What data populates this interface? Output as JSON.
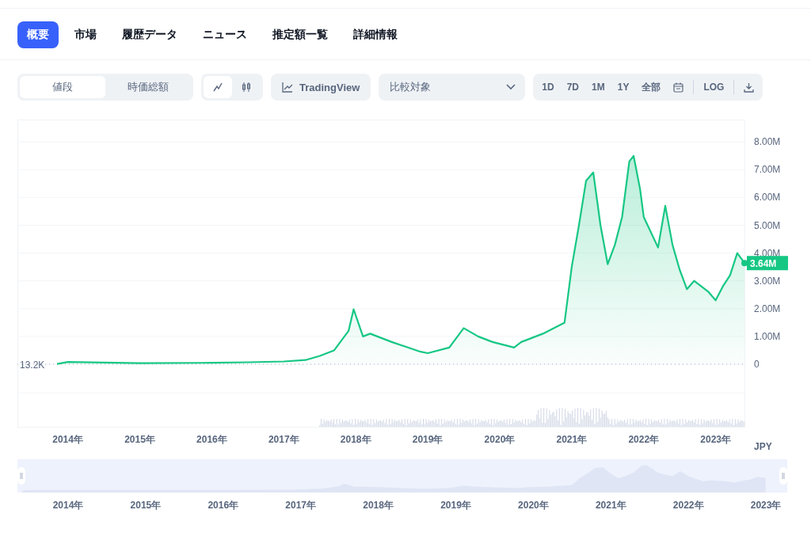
{
  "tabs": [
    {
      "label": "概要",
      "selected": true
    },
    {
      "label": "市場",
      "selected": false
    },
    {
      "label": "履歴データ",
      "selected": false
    },
    {
      "label": "ニュース",
      "selected": false
    },
    {
      "label": "推定額一覧",
      "selected": false
    },
    {
      "label": "詳細情報",
      "selected": false
    }
  ],
  "toolbar": {
    "metric": [
      {
        "label": "値段",
        "selected": true
      },
      {
        "label": "時価総額",
        "selected": false
      }
    ],
    "chart_type": [
      {
        "kind": "line",
        "selected": true
      },
      {
        "kind": "candle",
        "selected": false
      }
    ],
    "tradingview": {
      "label": "TradingView"
    },
    "compare": {
      "label": "比較対象"
    },
    "ranges": [
      {
        "label": "1D",
        "selected": false
      },
      {
        "label": "7D",
        "selected": false
      },
      {
        "label": "1M",
        "selected": false
      },
      {
        "label": "1Y",
        "selected": false
      },
      {
        "label": "全部",
        "selected": false
      }
    ],
    "log": {
      "label": "LOG",
      "selected": false
    }
  },
  "chart": {
    "start_label": "13.2K",
    "price_label": "3.64M",
    "currency": "JPY",
    "chart_data": {
      "type": "area",
      "x": [
        2013.85,
        2014.0,
        2014.5,
        2015.0,
        2016.0,
        2016.5,
        2017.0,
        2017.3,
        2017.5,
        2017.7,
        2017.9,
        2017.97,
        2018.1,
        2018.2,
        2018.5,
        2018.9,
        2019.0,
        2019.3,
        2019.5,
        2019.7,
        2019.9,
        2020.2,
        2020.3,
        2020.6,
        2020.9,
        2021.0,
        2021.1,
        2021.2,
        2021.3,
        2021.4,
        2021.5,
        2021.6,
        2021.7,
        2021.8,
        2021.86,
        2021.95,
        2022.0,
        2022.2,
        2022.3,
        2022.4,
        2022.5,
        2022.6,
        2022.7,
        2022.9,
        2023.0,
        2023.1,
        2023.2,
        2023.3,
        2023.4
      ],
      "series": [
        {
          "color": "#16c784",
          "values": [
            10000,
            80000,
            60000,
            40000,
            50000,
            70000,
            100000,
            150000,
            300000,
            500000,
            1200000,
            1980000,
            1000000,
            1100000,
            800000,
            450000,
            400000,
            600000,
            1300000,
            1000000,
            800000,
            600000,
            800000,
            1100000,
            1500000,
            3500000,
            5000000,
            6600000,
            6900000,
            5000000,
            3600000,
            4300000,
            5300000,
            7300000,
            7500000,
            6300000,
            5300000,
            4200000,
            5700000,
            4300000,
            3400000,
            2700000,
            3000000,
            2600000,
            2300000,
            2800000,
            3200000,
            4000000,
            3640000
          ]
        }
      ],
      "xlim": [
        2013.3,
        2023.4
      ],
      "ylim": [
        0,
        8000000
      ],
      "grid": true,
      "yticks": [
        {
          "value": 0,
          "label": "0"
        },
        {
          "value": 1000000,
          "label": "1.00M"
        },
        {
          "value": 2000000,
          "label": "2.00M"
        },
        {
          "value": 3000000,
          "label": "3.00M"
        },
        {
          "value": 4000000,
          "label": "4.00M"
        },
        {
          "value": 5000000,
          "label": "5.00M"
        },
        {
          "value": 6000000,
          "label": "6.00M"
        },
        {
          "value": 7000000,
          "label": "7.00M"
        },
        {
          "value": 8000000,
          "label": "8.00M"
        }
      ],
      "xticks": [
        {
          "value": 2014,
          "label": "2014年"
        },
        {
          "value": 2015,
          "label": "2015年"
        },
        {
          "value": 2016,
          "label": "2016年"
        },
        {
          "value": 2017,
          "label": "2017年"
        },
        {
          "value": 2018,
          "label": "2018年"
        },
        {
          "value": 2019,
          "label": "2019年"
        },
        {
          "value": 2020,
          "label": "2020年"
        },
        {
          "value": 2021,
          "label": "2021年"
        },
        {
          "value": 2022,
          "label": "2022年"
        },
        {
          "value": 2023,
          "label": "2023年"
        }
      ]
    }
  },
  "navigator": {
    "labels": [
      "2014年",
      "2015年",
      "2016年",
      "2017年",
      "2018年",
      "2019年",
      "2020年",
      "2021年",
      "2022年",
      "2023年"
    ]
  }
}
